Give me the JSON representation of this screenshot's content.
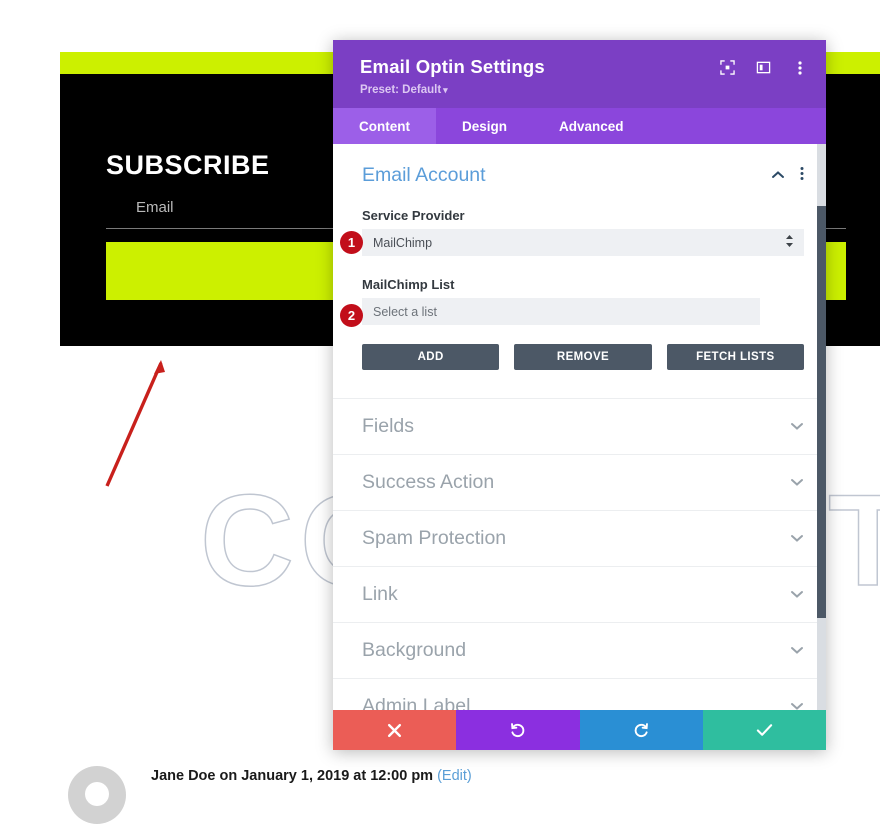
{
  "background_page": {
    "optin_widget": {
      "title": "SUBSCRIBE",
      "email_label": "Email",
      "submit_label": "",
      "bg_color": "#000000",
      "accent_color": "#ccf000"
    },
    "watermark_text": "COMMENTS",
    "comment": {
      "meta": "Jane Doe on January 1, 2019 at 12:00 pm",
      "edit_label": "(Edit)"
    }
  },
  "annotation": {
    "arrow_color": "#c8201c",
    "badges": [
      {
        "number": "1",
        "target": "service-provider-select"
      },
      {
        "number": "2",
        "target": "mailchimp-list-input"
      }
    ],
    "badge_color": "#c20e1a"
  },
  "modal": {
    "title": "Email Optin Settings",
    "preset_label": "Preset: Default",
    "preset_caret": "▾",
    "header_color": "#7b3fc4",
    "header_icons": [
      {
        "name": "focus-icon"
      },
      {
        "name": "layout-icon"
      },
      {
        "name": "more-vertical-icon"
      }
    ],
    "tabs": [
      {
        "label": "Content",
        "active": true
      },
      {
        "label": "Design",
        "active": false
      },
      {
        "label": "Advanced",
        "active": false
      }
    ],
    "open_section": {
      "title": "Email Account",
      "title_color": "#5b9dd9",
      "fields": [
        {
          "label": "Service Provider",
          "type": "select",
          "value": "MailChimp"
        },
        {
          "label": "MailChimp List",
          "type": "text",
          "value": "",
          "placeholder": "Select a list"
        }
      ],
      "buttons": [
        {
          "label": "ADD"
        },
        {
          "label": "REMOVE"
        },
        {
          "label": "FETCH LISTS"
        }
      ]
    },
    "collapsed_sections": [
      {
        "label": "Fields"
      },
      {
        "label": "Success Action"
      },
      {
        "label": "Spam Protection"
      },
      {
        "label": "Link"
      },
      {
        "label": "Background"
      },
      {
        "label": "Admin Label"
      }
    ],
    "footer_buttons": [
      {
        "name": "cancel-button",
        "icon": "✖",
        "color": "#eb5d56"
      },
      {
        "name": "undo-button",
        "icon": "↺",
        "color": "#8b2fe0"
      },
      {
        "name": "redo-button",
        "icon": "↻",
        "color": "#2a8fd4"
      },
      {
        "name": "save-button",
        "icon": "✔",
        "color": "#2fbe9f"
      }
    ]
  }
}
